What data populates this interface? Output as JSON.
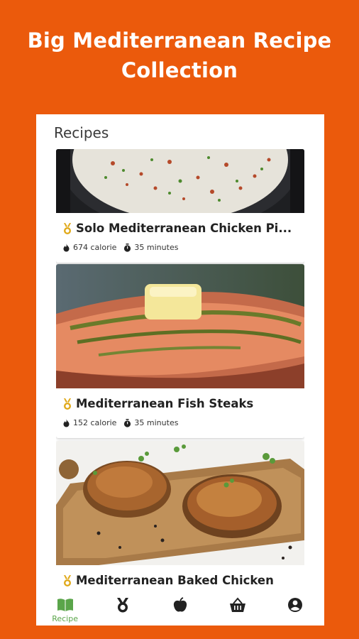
{
  "headline": {
    "line1": "Big Mediterranean Recipe",
    "line2": "Collection"
  },
  "screen": {
    "title": "Recipes"
  },
  "recipes": [
    {
      "name": "Solo Mediterranean Chicken Pi...",
      "calories": "674 calorie",
      "time": "35 minutes",
      "image": "rice-pilaf-in-pan"
    },
    {
      "name": "Mediterranean Fish Steaks",
      "calories": "152 calorie",
      "time": "35 minutes",
      "image": "salmon-with-butter-and-herbs"
    },
    {
      "name": "Mediterranean Baked Chicken",
      "calories": "",
      "time": "",
      "image": "baked-chicken-thighs-on-board"
    }
  ],
  "tabbar": {
    "items": [
      {
        "icon": "book-icon",
        "label": "Recipe",
        "active": true
      },
      {
        "icon": "medal-icon",
        "label": ""
      },
      {
        "icon": "apple-icon",
        "label": ""
      },
      {
        "icon": "basket-icon",
        "label": ""
      },
      {
        "icon": "account-icon",
        "label": ""
      }
    ]
  },
  "colors": {
    "background": "#eb5a0c",
    "accent": "#5aa54a",
    "medal": "#e0a91a"
  }
}
